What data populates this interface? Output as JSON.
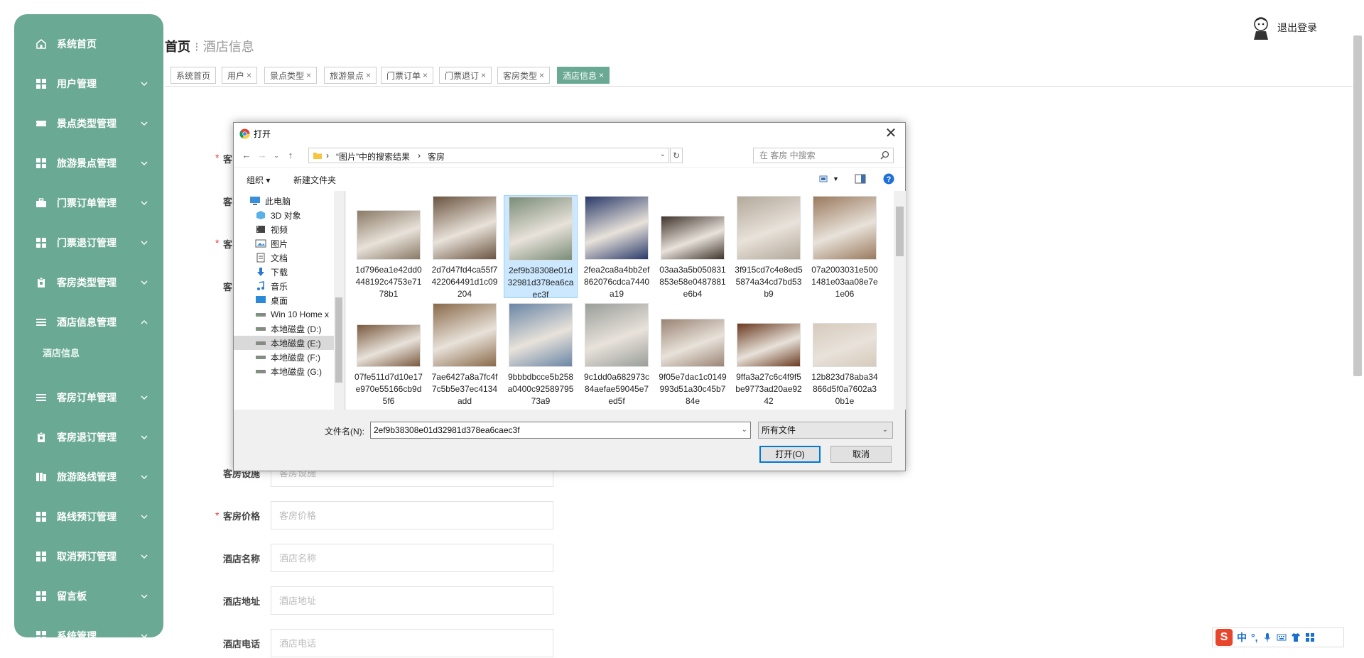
{
  "sidebar": {
    "items": [
      {
        "label": "系统首页",
        "icon": "home-icon"
      },
      {
        "label": "用户管理",
        "icon": "grid-icon"
      },
      {
        "label": "景点类型管理",
        "icon": "ticket-icon"
      },
      {
        "label": "旅游景点管理",
        "icon": "grid-icon"
      },
      {
        "label": "门票订单管理",
        "icon": "briefcase-icon"
      },
      {
        "label": "门票退订管理",
        "icon": "grid-icon"
      },
      {
        "label": "客房类型管理",
        "icon": "clipboard-icon"
      },
      {
        "label": "酒店信息管理",
        "icon": "list-icon"
      },
      {
        "label": "客房订单管理",
        "icon": "list-icon"
      },
      {
        "label": "客房退订管理",
        "icon": "clipboard-icon"
      },
      {
        "label": "旅游路线管理",
        "icon": "columns-icon"
      },
      {
        "label": "路线预订管理",
        "icon": "grid-icon"
      },
      {
        "label": "取消预订管理",
        "icon": "grid-icon"
      },
      {
        "label": "留言板",
        "icon": "grid-icon"
      },
      {
        "label": "系统管理",
        "icon": "grid-icon"
      }
    ],
    "submenu": {
      "label": "酒店信息"
    }
  },
  "breadcrumb": {
    "home": "首页",
    "current": "酒店信息"
  },
  "user": {
    "logout_label": "退出登录"
  },
  "tabs": [
    {
      "label": "系统首页",
      "closable": false
    },
    {
      "label": "用户",
      "closable": true
    },
    {
      "label": "景点类型",
      "closable": true
    },
    {
      "label": "旅游景点",
      "closable": true
    },
    {
      "label": "门票订单",
      "closable": true
    },
    {
      "label": "门票退订",
      "closable": true
    },
    {
      "label": "客房类型",
      "closable": true
    },
    {
      "label": "酒店信息",
      "closable": true,
      "active": true
    }
  ],
  "form": {
    "partial_labels": [
      "客",
      "客",
      "客",
      "客"
    ],
    "fields": [
      {
        "label": "客房设施",
        "placeholder": "客房设施",
        "required": false
      },
      {
        "label": "客房价格",
        "placeholder": "客房价格",
        "required": true
      },
      {
        "label": "酒店名称",
        "placeholder": "酒店名称",
        "required": false
      },
      {
        "label": "酒店地址",
        "placeholder": "酒店地址",
        "required": false
      },
      {
        "label": "酒店电话",
        "placeholder": "酒店电话",
        "required": false
      }
    ]
  },
  "dialog": {
    "title": "打开",
    "address": {
      "seg1": "›",
      "seg2": "“图片”中的搜索结果",
      "seg3": "›",
      "seg4": "客房"
    },
    "search_placeholder": "在 客房 中搜索",
    "toolbar": {
      "organize": "组织 ▾",
      "new_folder": "新建文件夹"
    },
    "nav": [
      {
        "label": "此电脑",
        "icon": "pc-icon",
        "indent": 0
      },
      {
        "label": "3D 对象",
        "icon": "cube-icon",
        "indent": 1
      },
      {
        "label": "视频",
        "icon": "video-icon",
        "indent": 1
      },
      {
        "label": "图片",
        "icon": "picture-icon",
        "indent": 1
      },
      {
        "label": "文档",
        "icon": "document-icon",
        "indent": 1
      },
      {
        "label": "下载",
        "icon": "download-icon",
        "indent": 1
      },
      {
        "label": "音乐",
        "icon": "music-icon",
        "indent": 1
      },
      {
        "label": "桌面",
        "icon": "desktop-icon",
        "indent": 1
      },
      {
        "label": "Win 10 Home x",
        "icon": "drive-icon",
        "indent": 1
      },
      {
        "label": "本地磁盘 (D:)",
        "icon": "drive-icon",
        "indent": 1
      },
      {
        "label": "本地磁盘 (E:)",
        "icon": "drive-icon",
        "indent": 1,
        "selected": true
      },
      {
        "label": "本地磁盘 (F:)",
        "icon": "drive-icon",
        "indent": 1
      },
      {
        "label": "本地磁盘 (G:)",
        "icon": "drive-icon",
        "indent": 1
      }
    ],
    "files": [
      {
        "name": "1d796ea1e42dd0448192c4753e7178b1",
        "color": "#8a7a66"
      },
      {
        "name": "2d7d47fd4ca55f7422064491d1c09204",
        "color": "#6b5440"
      },
      {
        "name": "2ef9b38308e01d32981d378ea6caec3f",
        "color": "#7a8c78",
        "selected": true
      },
      {
        "name": "2fea2ca8a4bb2ef862076cdca7440a19",
        "color": "#2a3a6a"
      },
      {
        "name": "03aa3a5b050831853e58e0487881e6b4",
        "color": "#3f342c"
      },
      {
        "name": "3f915cd7c4e8ed55874a34cd7bd53b9",
        "color": "#b3a89a"
      },
      {
        "name": "07a2003031e5001481e03aa08e7e1e06",
        "color": "#9a7a5e"
      },
      {
        "name": "07fe511d7d10e17e970e55166cb9d5f6",
        "color": "#7a5a40"
      },
      {
        "name": "7ae6427a8a7fc4f7c5b5e37ec4134add",
        "color": "#8a6a4a"
      },
      {
        "name": "9bbbdbcce5b258a0400c9258979573a9",
        "color": "#6a86a6"
      },
      {
        "name": "9c1dd0a682973c84aefae59045e7ed5f",
        "color": "#9a9e9a"
      },
      {
        "name": "9f05e7dac1c0149993d51a30c45b784e",
        "color": "#9a8474"
      },
      {
        "name": "9ffa3a27c6c4f9f5be9773ad20ae9242",
        "color": "#6a3a20"
      },
      {
        "name": "12b823d78aba34866d5f0a7602a30b1e",
        "color": "#d6cabc"
      }
    ],
    "filename_label": "文件名(N):",
    "filename_value": "2ef9b38308e01d32981d378ea6caec3f",
    "filetype": "所有文件",
    "open_label": "打开(O)",
    "cancel_label": "取消"
  },
  "ime": {
    "logo": "S",
    "lang": "中"
  }
}
